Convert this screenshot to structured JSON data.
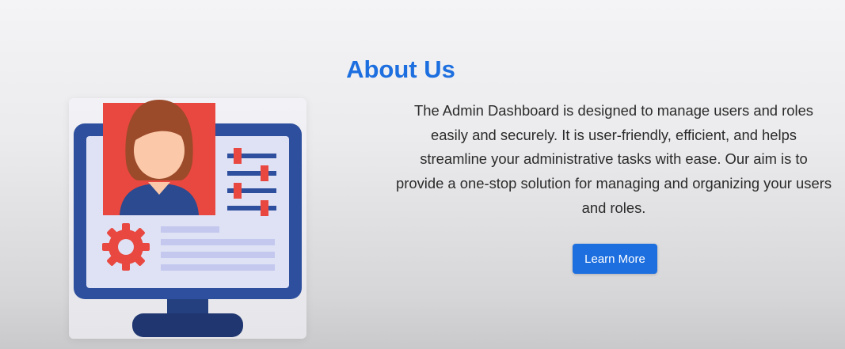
{
  "about": {
    "title": "About Us",
    "description": "The Admin Dashboard is designed to manage users and roles easily and securely. It is user-friendly, efficient, and helps streamline your administrative tasks with ease. Our aim is to provide a one-stop solution for managing and organizing your users and roles.",
    "button_label": "Learn More"
  },
  "illustration": {
    "icon": "admin-profile-monitor-icon",
    "colors": {
      "monitor": "#2d4f9d",
      "screen": "#dfe1f5",
      "profile_bg": "#e8483f",
      "hair": "#9b4a2a",
      "skin": "#fbc9a9",
      "shirt": "#2b4a8f",
      "gear": "#e8483f",
      "lines": "#c4c8ee"
    }
  },
  "colors": {
    "accent": "#1d6fe0",
    "text": "#2b2b2b"
  }
}
